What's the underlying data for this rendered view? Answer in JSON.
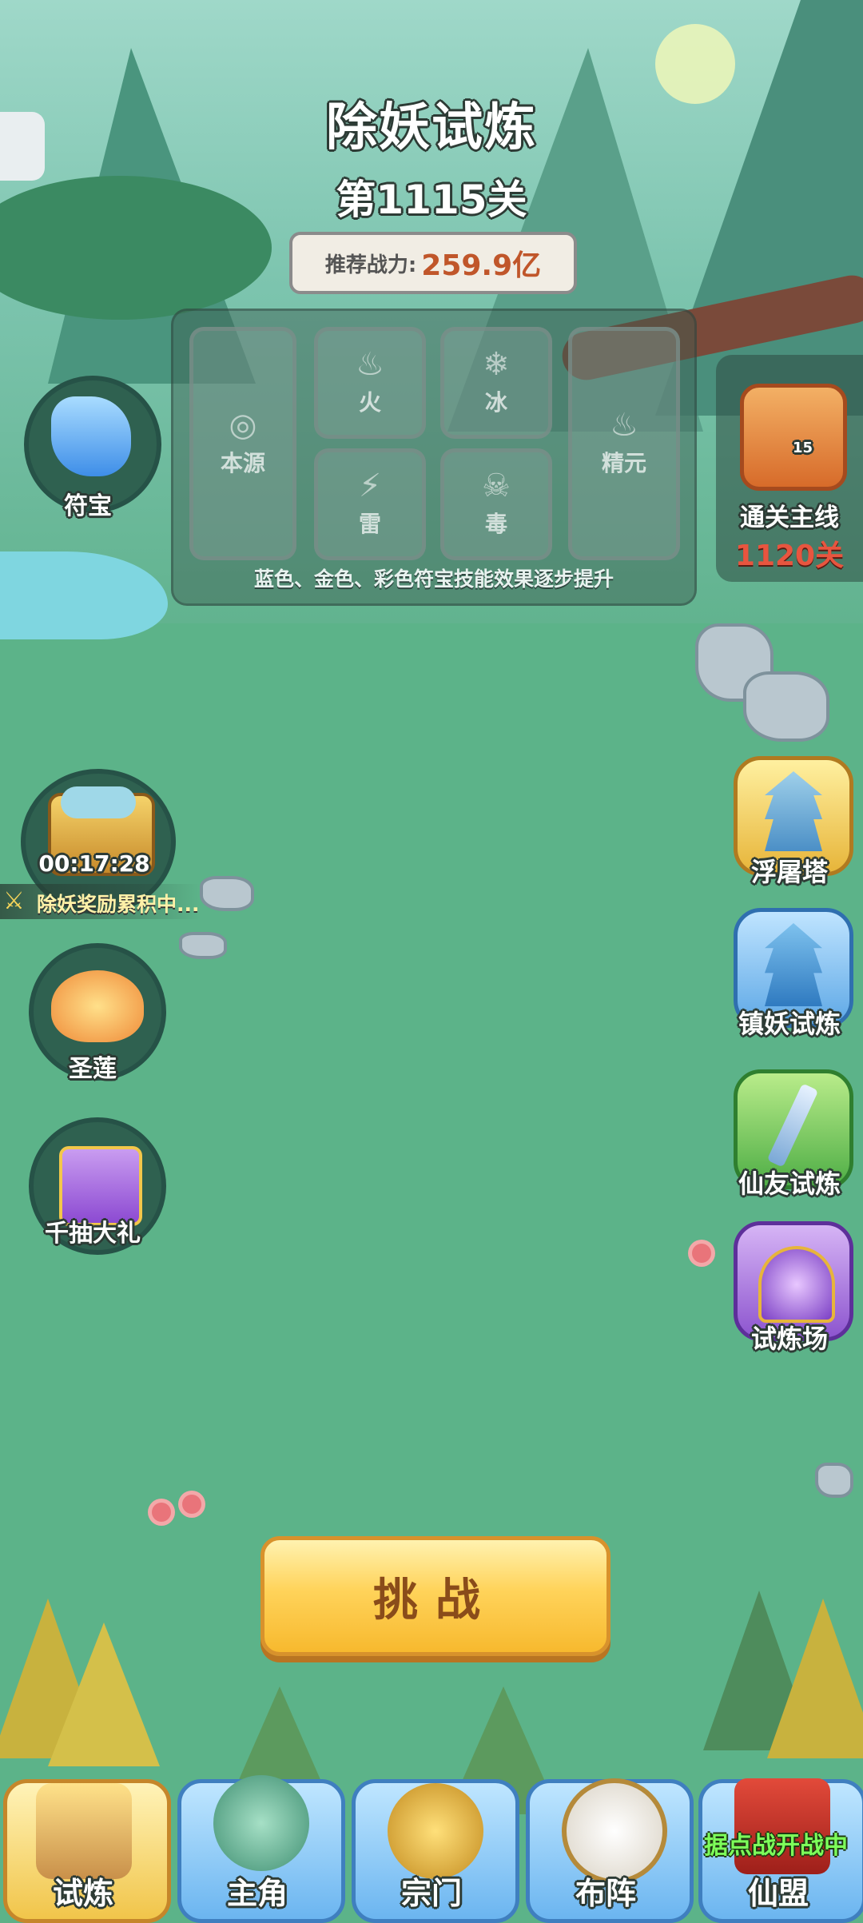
{
  "header": {
    "title": "除妖试炼",
    "stage": "第1115关",
    "power_label": "推荐战力:",
    "power_value": "259.9亿"
  },
  "panel": {
    "slots": [
      {
        "label": "本源",
        "icon": "swirl-icon"
      },
      {
        "label": "火",
        "icon": "fire-icon"
      },
      {
        "label": "冰",
        "icon": "snowflake-icon"
      },
      {
        "label": "精元",
        "icon": "flame-essence-icon"
      },
      {
        "label": "雷",
        "icon": "lightning-icon"
      },
      {
        "label": "毒",
        "icon": "skull-icon"
      }
    ],
    "note": "蓝色、金色、彩色符宝技能效果逐步提升"
  },
  "left_buttons": {
    "talisman": "符宝",
    "chest_timer": "00:17:28",
    "chest_note": "除妖奖励累积中...",
    "lotus": "圣莲",
    "gift": "千抽大礼"
  },
  "mainline": {
    "label": "通关主线",
    "stage": "1120关",
    "badge": "15"
  },
  "right_buttons": [
    "浮屠塔",
    "镇妖试炼",
    "仙友试炼",
    "试炼场"
  ],
  "challenge_label": "挑战",
  "nav": {
    "items": [
      "试炼",
      "主角",
      "宗门",
      "布阵",
      "仙盟"
    ],
    "alliance_banner": "据点战开战中"
  },
  "colors": {
    "accent_orange": "#c0562a",
    "mainline_red": "#e8553f",
    "nav_active": "#f1c54a",
    "nav_inactive": "#6bb5f0"
  }
}
